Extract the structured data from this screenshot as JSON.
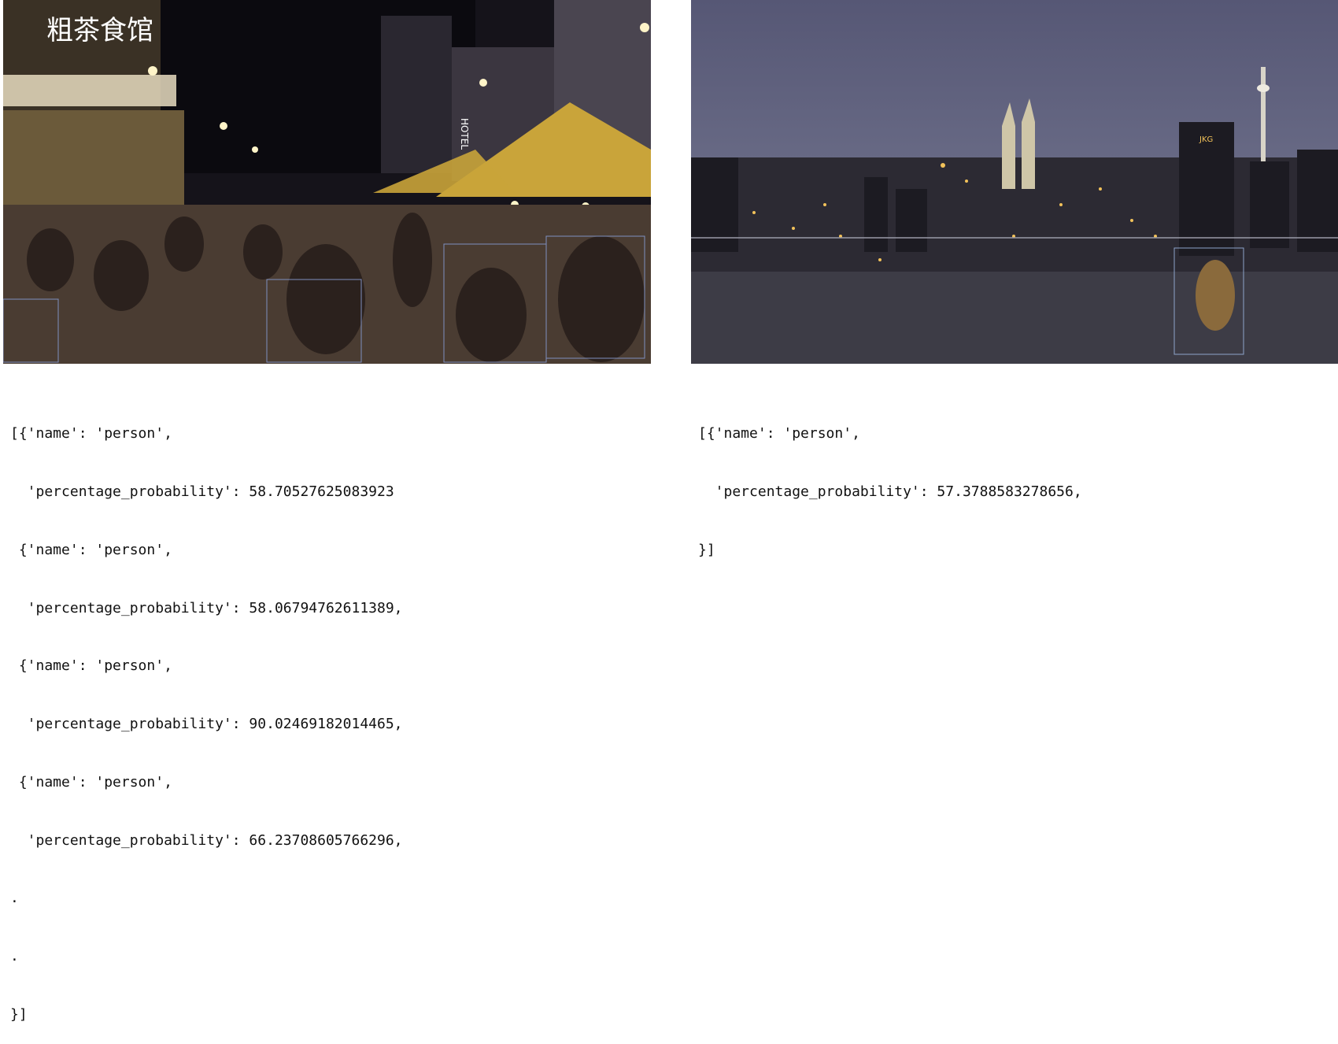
{
  "left_panel": {
    "image": {
      "scene": "crowded night street food market with yellow tents",
      "sign_text": "粗茶食馆",
      "hotel_sign": "HOTEL",
      "colors": {
        "tent": "#c9a43a",
        "sky": "#0e0c12"
      }
    },
    "output_lines": [
      "[{'name': 'person',",
      "  'percentage_probability': 58.70527625083923",
      " {'name': 'person',",
      "  'percentage_probability': 58.06794762611389,",
      " {'name': 'person',",
      "  'percentage_probability': 90.02469182014465,",
      " {'name': 'person',",
      "  'percentage_probability': 66.23708605766296,",
      ".",
      ".",
      "}]"
    ]
  },
  "right_panel": {
    "image": {
      "scene": "night city skyline seen from a rooftop with one detected person",
      "building_sign": "JKG",
      "colors": {
        "sky": "#5b5d7a",
        "lights": "#f2c25a",
        "box": "#8da3c9"
      }
    },
    "output_lines": [
      "[{'name': 'person',",
      "  'percentage_probability': 57.3788583278656,",
      "}]"
    ]
  }
}
